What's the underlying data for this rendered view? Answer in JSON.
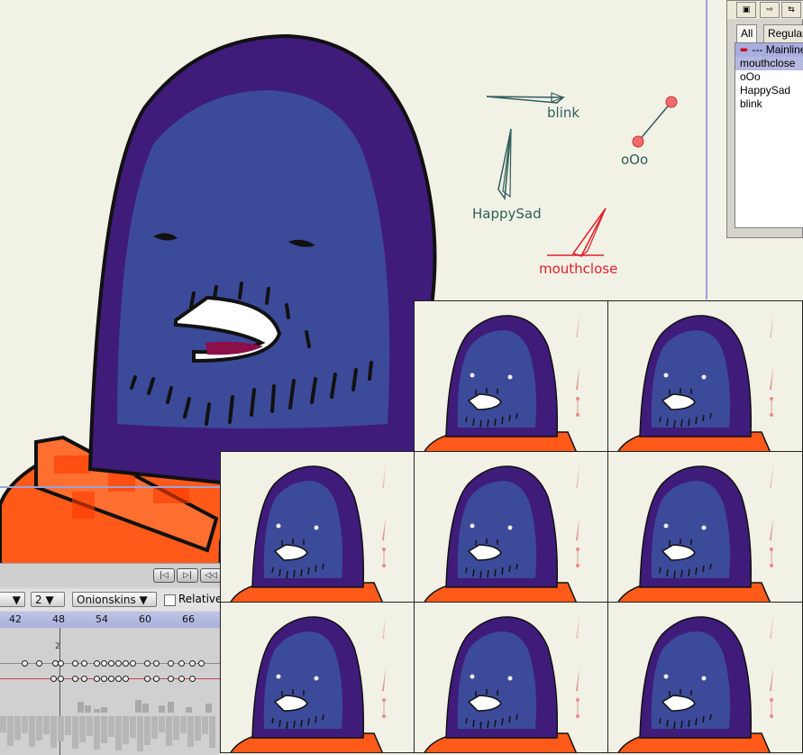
{
  "timeline": {
    "onion_count": "2",
    "onionskins_label": "Onionskins",
    "relative_label": "Relative",
    "frame_ticks": [
      "42",
      "48",
      "54",
      "60",
      "66"
    ],
    "current_frame_marker": "2",
    "nav_buttons": [
      "first-frame-icon",
      "step-back-icon",
      "rewind-icon"
    ]
  },
  "properties_panel": {
    "tabs": [
      "All",
      "Regular"
    ],
    "items": [
      "--- Mainline",
      "mouthclose",
      "oOo",
      "HappySad",
      "blink"
    ],
    "selected_item": "mouthclose"
  },
  "canvas": {
    "controls": [
      "blink",
      "oOo",
      "HappySad",
      "mouthclose"
    ],
    "active_control": "mouthclose"
  },
  "colors": {
    "background": "#f2f1e6",
    "character_body": "#3f1b7a",
    "character_face": "#3c4a9a",
    "shirt": "#ff5a1a",
    "control_teal": "#2f5e5a",
    "control_active_red": "#e0202a",
    "guide_line": "#9ea3d6"
  }
}
